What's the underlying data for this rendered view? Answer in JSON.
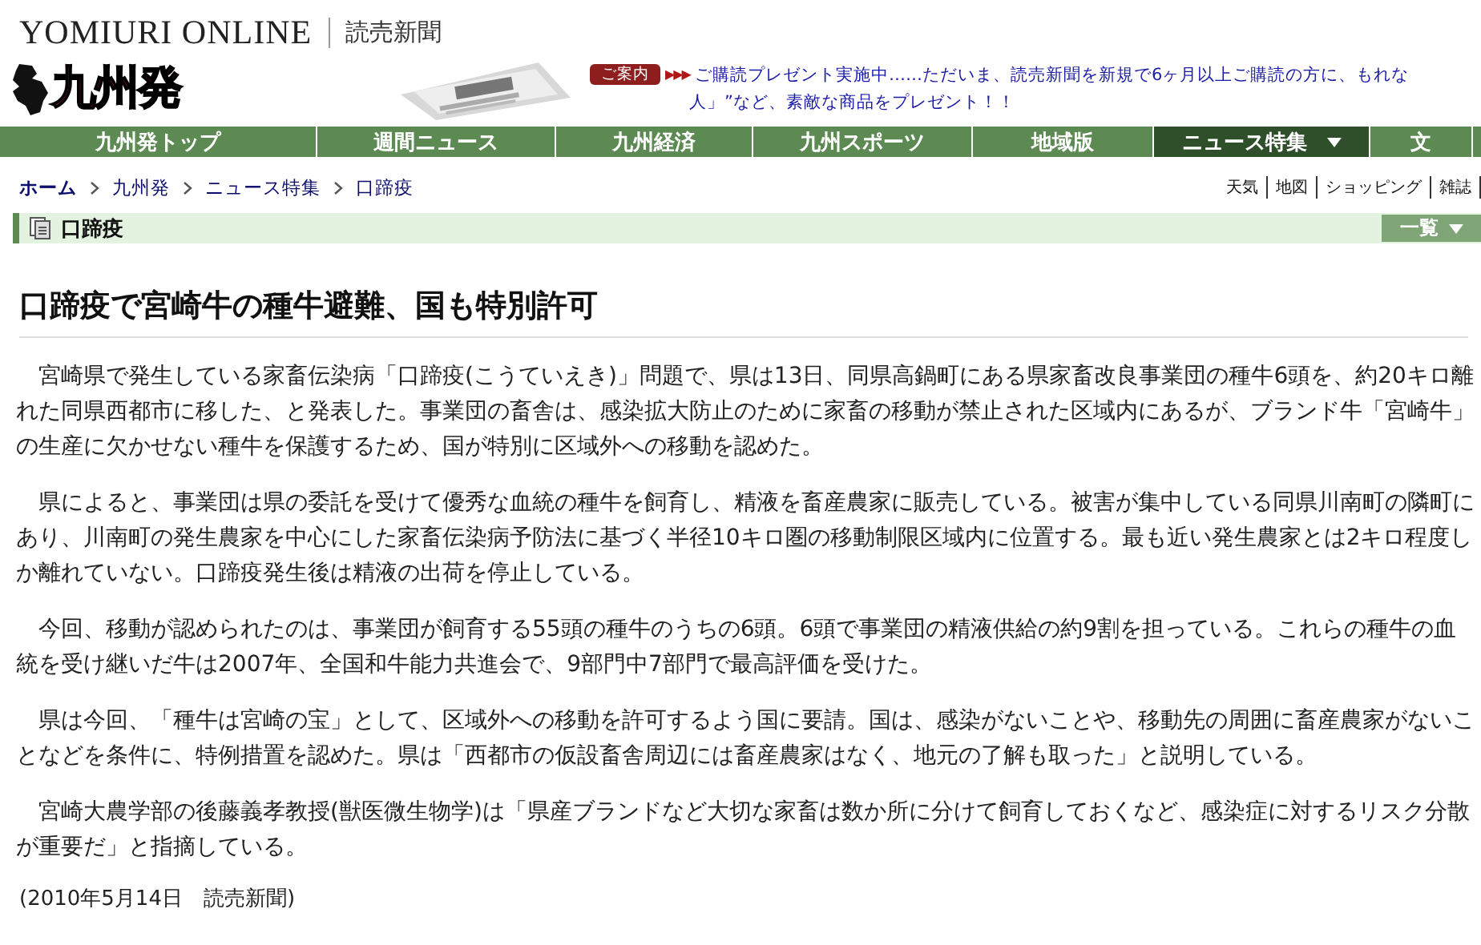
{
  "header": {
    "brand": "YOMIURI ONLINE",
    "paper": "読売新聞"
  },
  "banner": {
    "logo": "九州発",
    "badge": "ご案内",
    "arrows": "▶▶▶",
    "lines": [
      "ご購読プレゼント実施中……ただいま、読売新聞を新規で6ヶ月以上ご購読の方に、もれな",
      "人」”など、素敵な商品をプレゼント！！"
    ]
  },
  "nav": [
    {
      "label": "九州発トップ",
      "selected": false
    },
    {
      "label": "週間ニュース",
      "selected": false
    },
    {
      "label": "九州経済",
      "selected": false
    },
    {
      "label": "九州スポーツ",
      "selected": false
    },
    {
      "label": "地域版",
      "selected": false
    },
    {
      "label": "ニュース特集",
      "selected": true,
      "dropdown": true
    },
    {
      "label": "文",
      "selected": false
    }
  ],
  "breadcrumb": [
    "ホーム",
    "九州発",
    "ニュース特集",
    "口蹄疫"
  ],
  "quick_links": [
    "天気",
    "地図",
    "ショッピング",
    "雑誌"
  ],
  "section": {
    "title": "口蹄疫",
    "list_button": "一覧"
  },
  "article": {
    "title": "口蹄疫で宮崎牛の種牛避難、国も特別許可",
    "paragraphs": [
      "宮崎県で発生している家畜伝染病「口蹄疫(こうていえき)」問題で、県は13日、同県高鍋町にある県家畜改良事業団の種牛6頭を、約20キロ離れた同県西都市に移した、と発表した。事業団の畜舎は、感染拡大防止のために家畜の移動が禁止された区域内にあるが、ブランド牛「宮崎牛」の生産に欠かせない種牛を保護するため、国が特別に区域外への移動を認めた。",
      "県によると、事業団は県の委託を受けて優秀な血統の種牛を飼育し、精液を畜産農家に販売している。被害が集中している同県川南町の隣町にあり、川南町の発生農家を中心にした家畜伝染病予防法に基づく半径10キロ圏の移動制限区域内に位置する。最も近い発生農家とは2キロ程度しか離れていない。口蹄疫発生後は精液の出荷を停止している。",
      "今回、移動が認められたのは、事業団が飼育する55頭の種牛のうちの6頭。6頭で事業団の精液供給の約9割を担っている。これらの種牛の血統を受け継いだ牛は2007年、全国和牛能力共進会で、9部門中7部門で最高評価を受けた。",
      "県は今回、「種牛は宮崎の宝」として、区域外への移動を許可するよう国に要請。国は、感染がないことや、移動先の周囲に畜産農家がないことなどを条件に、特例措置を認めた。県は「西都市の仮設畜舎周辺には畜産農家はなく、地元の了解も取った」と説明している。",
      "宮崎大農学部の後藤義孝教授(獣医微生物学)は「県産ブランドなど大切な家畜は数か所に分けて飼育しておくなど、感染症に対するリスク分散が重要だ」と指摘している。"
    ],
    "dateline": "(2010年5月14日　読売新聞)"
  }
}
